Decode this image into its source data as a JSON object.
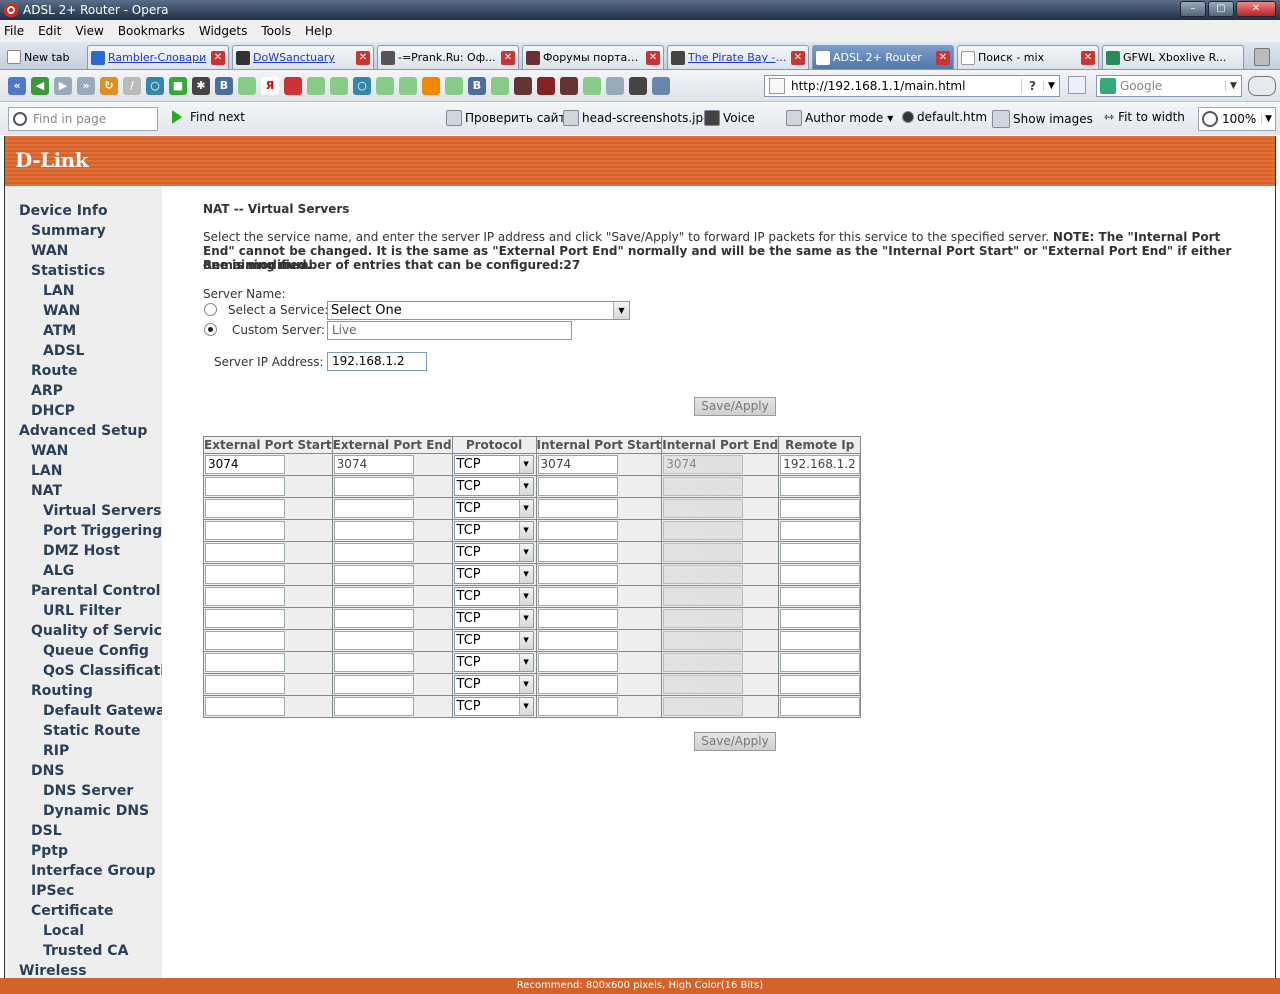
{
  "window": {
    "title": "ADSL 2+ Router - Opera"
  },
  "menu": [
    "File",
    "Edit",
    "View",
    "Bookmarks",
    "Widgets",
    "Tools",
    "Help"
  ],
  "tabs": [
    {
      "label": "New tab"
    },
    {
      "label": "Rambler-Словари"
    },
    {
      "label": "DoWSanctuary"
    },
    {
      "label": "-=Prank.Ru: Оф..."
    },
    {
      "label": "Форумы портал..."
    },
    {
      "label": "The Pirate Bay - ..."
    },
    {
      "label": "ADSL 2+ Router"
    },
    {
      "label": "Поиск - mix"
    },
    {
      "label": "GFWL Xboxlive R..."
    }
  ],
  "address": {
    "url": "http://192.168.1.1/main.html",
    "search_placeholder": "Google"
  },
  "findbar": {
    "find_placeholder": "Find in page",
    "find_next": "Find next",
    "items": [
      "Проверить сайт!",
      "head-screenshots.jpg",
      "Voice",
      "Author mode",
      "default.htm",
      "Show images",
      "Fit to width"
    ],
    "zoom": "100%"
  },
  "brand": {
    "logo": "D-Link"
  },
  "sidebar": [
    {
      "label": "Device Info",
      "level": 0
    },
    {
      "label": "Summary",
      "level": 1
    },
    {
      "label": "WAN",
      "level": 1
    },
    {
      "label": "Statistics",
      "level": 1
    },
    {
      "label": "LAN",
      "level": 2
    },
    {
      "label": "WAN",
      "level": 2
    },
    {
      "label": "ATM",
      "level": 2
    },
    {
      "label": "ADSL",
      "level": 2
    },
    {
      "label": "Route",
      "level": 1
    },
    {
      "label": "ARP",
      "level": 1
    },
    {
      "label": "DHCP",
      "level": 1
    },
    {
      "label": "Advanced Setup",
      "level": 0
    },
    {
      "label": "WAN",
      "level": 1
    },
    {
      "label": "LAN",
      "level": 1
    },
    {
      "label": "NAT",
      "level": 1
    },
    {
      "label": "Virtual Servers",
      "level": 2
    },
    {
      "label": "Port Triggering",
      "level": 2
    },
    {
      "label": "DMZ Host",
      "level": 2
    },
    {
      "label": "ALG",
      "level": 2
    },
    {
      "label": "Parental Control",
      "level": 1
    },
    {
      "label": "URL Filter",
      "level": 2
    },
    {
      "label": "Quality of Service",
      "level": 1
    },
    {
      "label": "Queue Config",
      "level": 2
    },
    {
      "label": "QoS Classification",
      "level": 2
    },
    {
      "label": "Routing",
      "level": 1
    },
    {
      "label": "Default Gateway",
      "level": 2
    },
    {
      "label": "Static Route",
      "level": 2
    },
    {
      "label": "RIP",
      "level": 2
    },
    {
      "label": "DNS",
      "level": 1
    },
    {
      "label": "DNS Server",
      "level": 2
    },
    {
      "label": "Dynamic DNS",
      "level": 2
    },
    {
      "label": "DSL",
      "level": 1
    },
    {
      "label": "Pptp",
      "level": 1
    },
    {
      "label": "Interface Group",
      "level": 1
    },
    {
      "label": "IPSec",
      "level": 1
    },
    {
      "label": "Certificate",
      "level": 1
    },
    {
      "label": "Local",
      "level": 2
    },
    {
      "label": "Trusted CA",
      "level": 2
    },
    {
      "label": "Wireless",
      "level": 0
    }
  ],
  "page": {
    "title": "NAT -- Virtual Servers",
    "desc_plain": "Select the service name, and enter the server IP address and click \"Save/Apply\" to forward IP packets for this service to the specified server. ",
    "desc_note": "NOTE: The \"Internal Port End\" cannot be changed. It is the same as \"External Port End\" normally and will be the same as the \"Internal Port Start\" or \"External Port End\" if either one is modified.",
    "remaining": "Remaining number of entries that can be configured:27",
    "server_name_label": "Server Name:",
    "select_service_label": "Select a Service:",
    "select_service_value": "Select One",
    "custom_server_label": "Custom Server:",
    "custom_server_value": "Live",
    "server_ip_label": "Server IP Address:",
    "server_ip_value": "192.168.1.2",
    "save_label": "Save/Apply"
  },
  "table": {
    "headers": [
      "External Port Start",
      "External Port End",
      "Protocol",
      "Internal Port Start",
      "Internal Port End",
      "Remote Ip"
    ],
    "rows": [
      {
        "ext_start": "3074",
        "ext_end": "3074",
        "protocol": "TCP",
        "int_start": "3074",
        "int_end": "3074",
        "remote_ip": "192.168.1.2"
      },
      {
        "ext_start": "",
        "ext_end": "",
        "protocol": "TCP",
        "int_start": "",
        "int_end": "",
        "remote_ip": ""
      },
      {
        "ext_start": "",
        "ext_end": "",
        "protocol": "TCP",
        "int_start": "",
        "int_end": "",
        "remote_ip": ""
      },
      {
        "ext_start": "",
        "ext_end": "",
        "protocol": "TCP",
        "int_start": "",
        "int_end": "",
        "remote_ip": ""
      },
      {
        "ext_start": "",
        "ext_end": "",
        "protocol": "TCP",
        "int_start": "",
        "int_end": "",
        "remote_ip": ""
      },
      {
        "ext_start": "",
        "ext_end": "",
        "protocol": "TCP",
        "int_start": "",
        "int_end": "",
        "remote_ip": ""
      },
      {
        "ext_start": "",
        "ext_end": "",
        "protocol": "TCP",
        "int_start": "",
        "int_end": "",
        "remote_ip": ""
      },
      {
        "ext_start": "",
        "ext_end": "",
        "protocol": "TCP",
        "int_start": "",
        "int_end": "",
        "remote_ip": ""
      },
      {
        "ext_start": "",
        "ext_end": "",
        "protocol": "TCP",
        "int_start": "",
        "int_end": "",
        "remote_ip": ""
      },
      {
        "ext_start": "",
        "ext_end": "",
        "protocol": "TCP",
        "int_start": "",
        "int_end": "",
        "remote_ip": ""
      },
      {
        "ext_start": "",
        "ext_end": "",
        "protocol": "TCP",
        "int_start": "",
        "int_end": "",
        "remote_ip": ""
      },
      {
        "ext_start": "",
        "ext_end": "",
        "protocol": "TCP",
        "int_start": "",
        "int_end": "",
        "remote_ip": ""
      }
    ]
  },
  "status": {
    "recommend": "Recommend: 800x600 pixels, High Color(16 Bits)"
  },
  "colors": {
    "brand_orange": "#e0652a",
    "sidebar_text": "#2a3f5a",
    "sidebar_bg": "#eeeeee"
  }
}
